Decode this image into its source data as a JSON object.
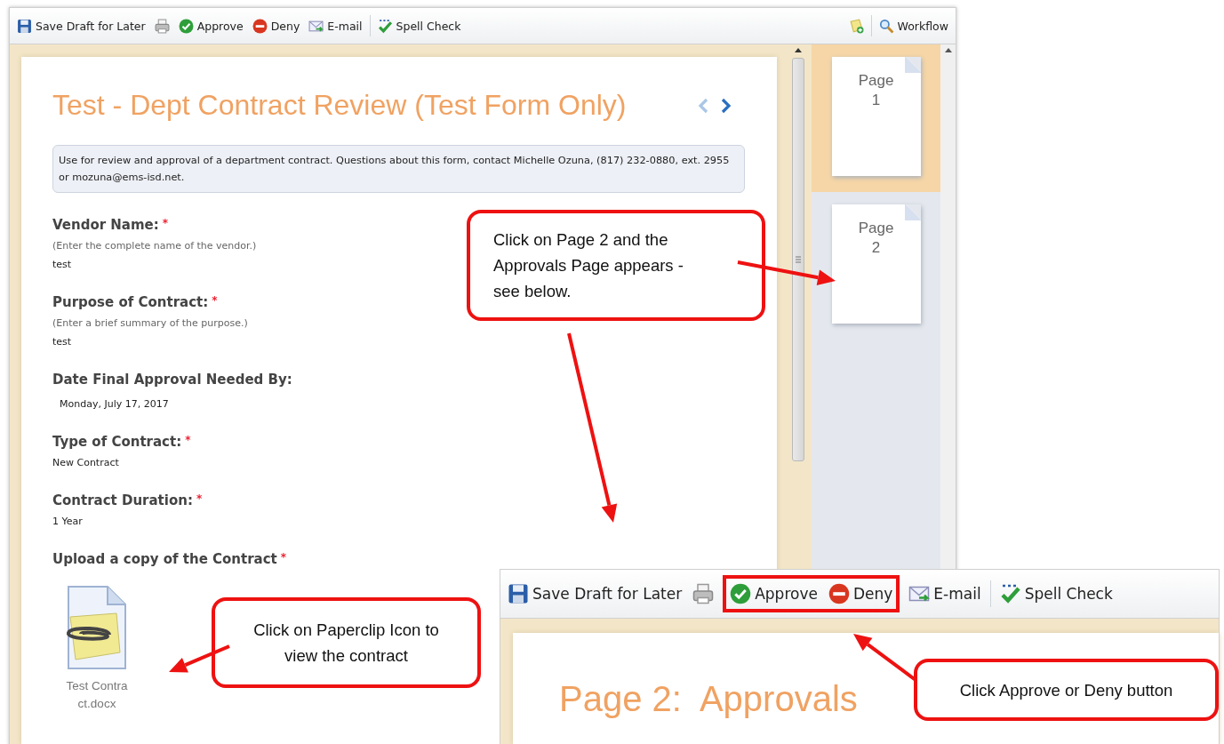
{
  "toolbar": {
    "items": [
      {
        "kind": "save",
        "label": "Save Draft for Later"
      },
      {
        "kind": "print"
      },
      {
        "kind": "approve",
        "label": "Approve"
      },
      {
        "kind": "deny",
        "label": "Deny"
      },
      {
        "kind": "email",
        "label": "E-mail"
      },
      {
        "kind": "separator"
      },
      {
        "kind": "spellcheck",
        "label": "Spell Check"
      }
    ],
    "right_items": [
      {
        "kind": "note"
      },
      {
        "kind": "separator"
      },
      {
        "kind": "search",
        "label": "Workflow"
      }
    ]
  },
  "form": {
    "title": "Test - Dept Contract Review (Test Form Only)",
    "nav": [
      {
        "kind": "prev",
        "disabled": true
      },
      {
        "kind": "next",
        "disabled": false
      }
    ],
    "info": "Use for review and approval of a department contract. Questions about this form, contact Michelle Ozuna, (817) 232-0880, ext. 2955 or mozuna@ems-isd.net.",
    "fields": [
      {
        "label": "Vendor Name:",
        "required_mark": "*",
        "hint": "(Enter the complete name of the vendor.)",
        "value": "test"
      },
      {
        "label": "Purpose of Contract:",
        "required_mark": "*",
        "hint": "(Enter a brief summary of the purpose.)",
        "value": "test"
      },
      {
        "label": "Date Final Approval Needed By:",
        "kind": "date",
        "value": "Monday, July 17, 2017"
      },
      {
        "label": "Type of Contract:",
        "required_mark": "*",
        "value": "New Contract"
      },
      {
        "label": "Contract Duration:",
        "required_mark": "*",
        "value": "1 Year"
      },
      {
        "label": "Upload a copy of the Contract",
        "required_mark": "*",
        "attachment": "Test Contract.docx"
      }
    ]
  },
  "pages": [
    {
      "label": "Page 1",
      "selected": true
    },
    {
      "label": "Page 2",
      "selected": false
    }
  ],
  "inset": {
    "toolbar": [
      {
        "kind": "save",
        "label": "Save Draft for Later",
        "highlighted": false
      },
      {
        "kind": "print",
        "highlighted": false
      },
      {
        "kind": "approve",
        "label": "Approve",
        "highlighted": true
      },
      {
        "kind": "deny",
        "label": "Deny",
        "highlighted": true
      },
      {
        "kind": "email",
        "label": "E-mail",
        "highlighted": false
      },
      {
        "kind": "separator"
      },
      {
        "kind": "spellcheck",
        "label": "Spell Check",
        "highlighted": false
      }
    ],
    "title": "Page 2:  Approvals"
  },
  "callouts": [
    {
      "text": "Click on Page 2 and the Approvals Page appears - see below."
    },
    {
      "text": "Click on Paperclip Icon to view the contract"
    },
    {
      "text": "Click Approve or Deny button"
    }
  ]
}
